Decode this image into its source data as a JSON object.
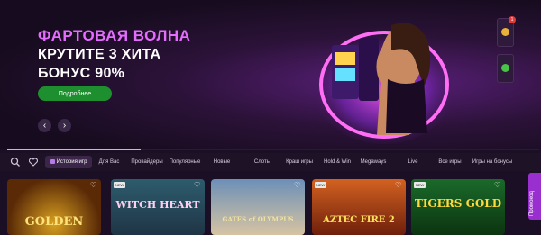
{
  "hero": {
    "title": "ФАРТОВАЯ ВОЛНА",
    "line1": "КРУТИТЕ 3 ХИТА",
    "line2": "БОНУС 90%",
    "button_label": "Подробнее",
    "prev_arrow": "‹",
    "next_arrow": "›",
    "slide_progress": 0.25
  },
  "side_badges": {
    "badge1_count": "1"
  },
  "categories": {
    "tabs": [
      "История игр",
      "Для Вас",
      "Провайдеры",
      "Популярные",
      "Новые",
      "Слоты",
      "Краш игры",
      "Hold & Win",
      "Megaways",
      "Live",
      "Все игры",
      "Игры на бонусы"
    ],
    "active_index": 0
  },
  "games": [
    {
      "name": "GOLDEN",
      "tag": ""
    },
    {
      "name": "WITCH HEART",
      "tag": "NEW"
    },
    {
      "name": "GATES of OLYMPUS",
      "tag": ""
    },
    {
      "name": "AZTEC FIRE 2",
      "tag": "NEW"
    },
    {
      "name": "TIGERS GOLD",
      "tag": "NEW"
    }
  ],
  "promo_tab": {
    "label": "Промокод"
  },
  "colors": {
    "accent": "#e46cff",
    "button_green": "#1e8f2f",
    "background": "#1a0f24"
  }
}
